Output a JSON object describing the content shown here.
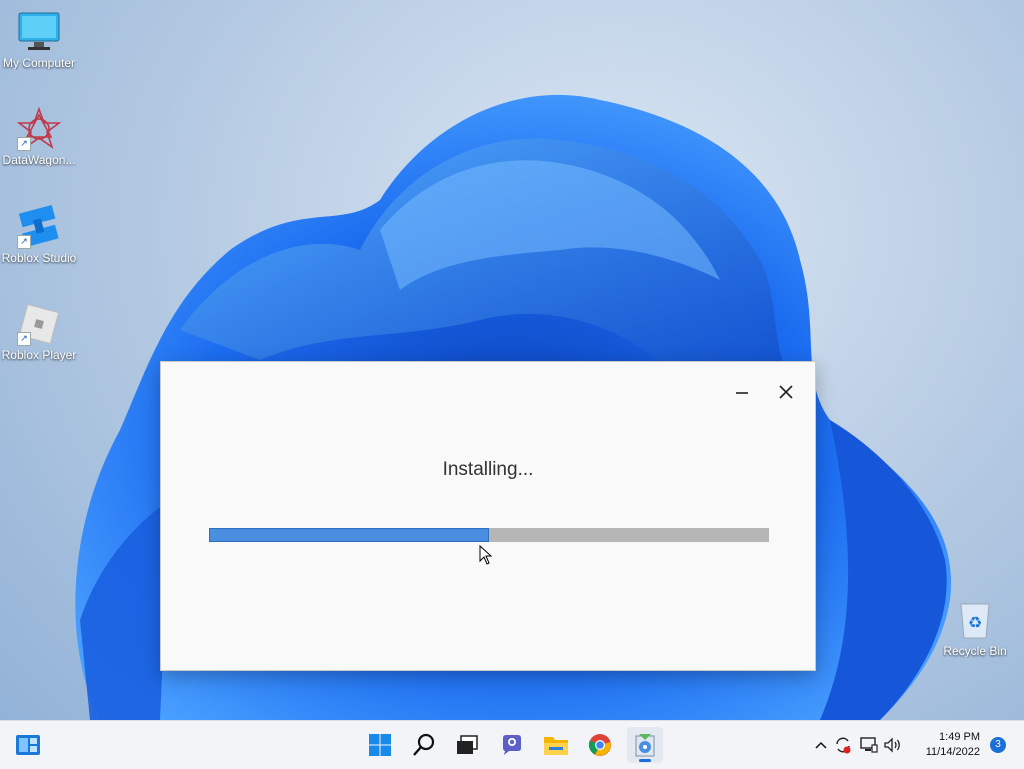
{
  "desktop": {
    "icons": [
      {
        "label": "My Computer",
        "icon": "computer-icon"
      },
      {
        "label": "DataWagon...",
        "icon": "datawagon-icon"
      },
      {
        "label": "Roblox Studio",
        "icon": "roblox-studio-icon"
      },
      {
        "label": "Roblox Player",
        "icon": "roblox-player-icon"
      },
      {
        "label": "Recycle Bin",
        "icon": "recycle-bin-icon"
      }
    ]
  },
  "installer": {
    "status_text": "Installing...",
    "progress_fraction": 0.5,
    "accent_color": "#4a8ee0"
  },
  "taskbar": {
    "pinned": [
      "start-icon",
      "search-icon",
      "task-view-icon",
      "teams-chat-icon",
      "file-explorer-icon",
      "chrome-icon",
      "installer-app-icon"
    ],
    "time": "1:49 PM",
    "date": "11/14/2022",
    "notification_count": "3"
  }
}
